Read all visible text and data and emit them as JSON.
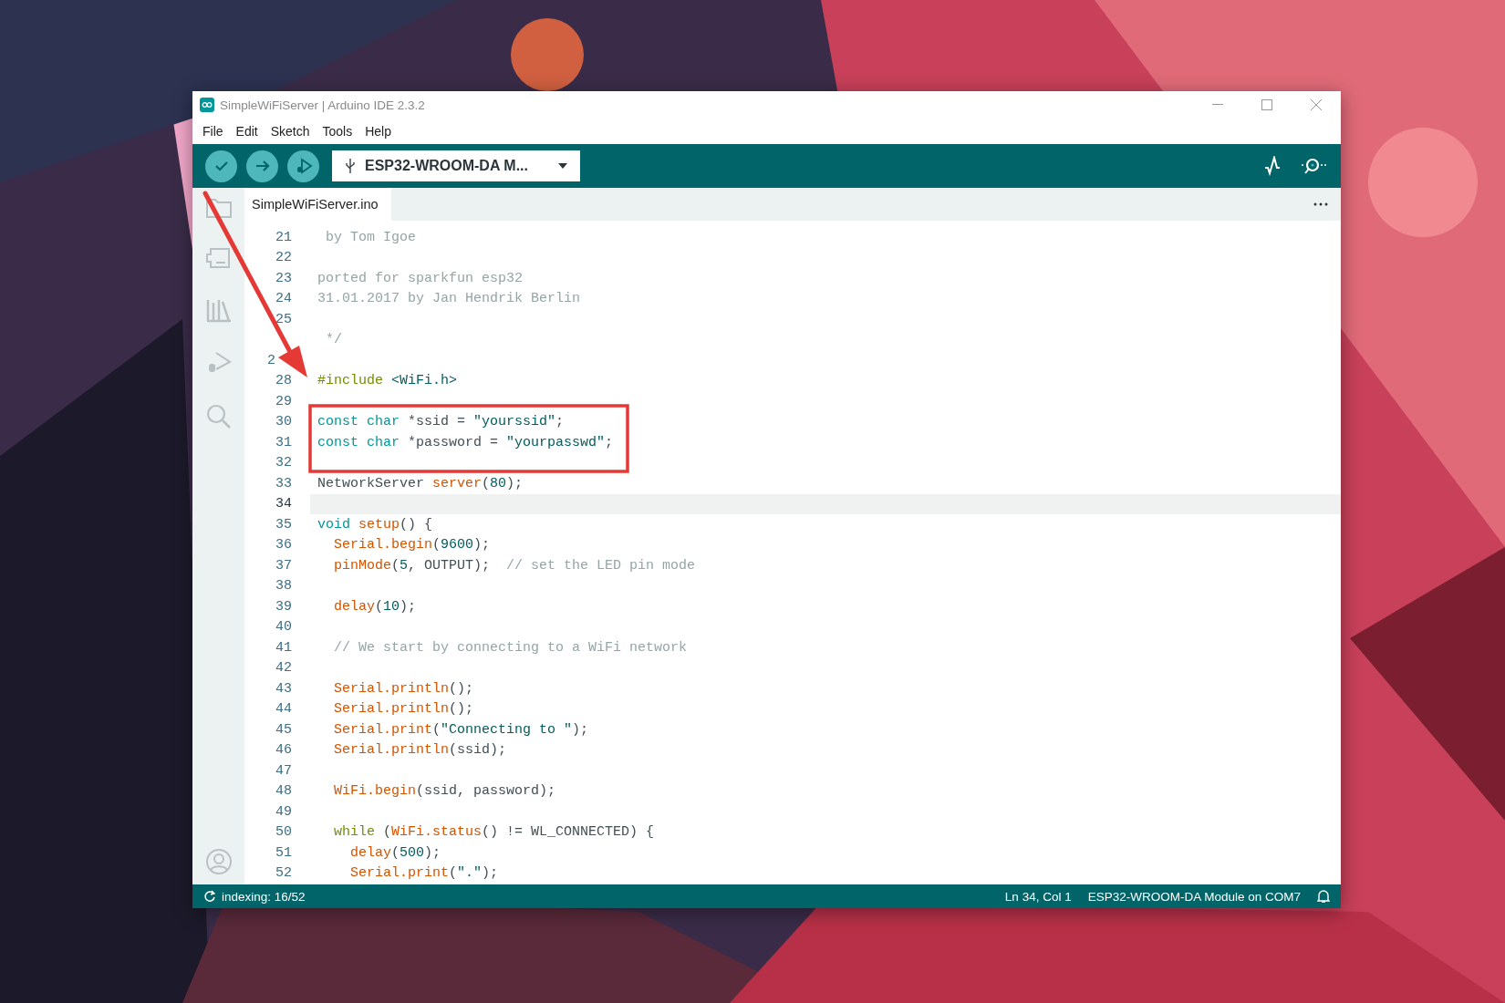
{
  "window": {
    "title": "SimpleWiFiServer | Arduino IDE 2.3.2"
  },
  "menu": [
    "File",
    "Edit",
    "Sketch",
    "Tools",
    "Help"
  ],
  "toolbar": {
    "board_selector": "ESP32-WROOM-DA M..."
  },
  "tabs": [
    {
      "label": "SimpleWiFiServer.ino",
      "selected": true
    }
  ],
  "editor": {
    "lines": [
      {
        "number": "21",
        "tokens": [
          {
            "kind": "comment",
            "text": " by Tom Igoe"
          }
        ]
      },
      {
        "number": "22"
      },
      {
        "number": "23",
        "tokens": [
          {
            "kind": "comment",
            "text": "ported for sparkfun esp32"
          }
        ]
      },
      {
        "number": "24",
        "tokens": [
          {
            "kind": "comment",
            "text": "31.01.2017 by Jan Hendrik Berlin"
          }
        ]
      },
      {
        "number": "25"
      },
      {
        "tokens": [
          {
            "kind": "comment",
            "text": " */"
          }
        ]
      },
      {
        "number": "2"
      },
      {
        "number": "28",
        "tokens": [
          {
            "kind": "preproc",
            "text": "#include"
          },
          {
            "kind": "string",
            "text": " <WiFi.h>"
          }
        ]
      },
      {
        "number": "29"
      },
      {
        "number": "30",
        "tokens": [
          {
            "kind": "keyword",
            "text": "const char"
          },
          {
            "kind": "plain",
            "text": " *ssid = "
          },
          {
            "kind": "string",
            "text": "\"yourssid\""
          },
          {
            "kind": "plain",
            "text": ";"
          }
        ]
      },
      {
        "number": "31",
        "tokens": [
          {
            "kind": "keyword",
            "text": "const char"
          },
          {
            "kind": "plain",
            "text": " *password = "
          },
          {
            "kind": "string",
            "text": "\"yourpasswd\""
          },
          {
            "kind": "plain",
            "text": ";"
          }
        ]
      },
      {
        "number": "32"
      },
      {
        "number": "33",
        "tokens": [
          {
            "kind": "plain",
            "text": "NetworkServer "
          },
          {
            "kind": "function",
            "text": "server"
          },
          {
            "kind": "plain",
            "text": "("
          },
          {
            "kind": "number",
            "text": "80"
          },
          {
            "kind": "plain",
            "text": ");"
          }
        ]
      },
      {
        "number": "34",
        "current": true
      },
      {
        "number": "35",
        "tokens": [
          {
            "kind": "keyword",
            "text": "void"
          },
          {
            "kind": "function",
            "text": " setup"
          },
          {
            "kind": "plain",
            "text": "() {"
          }
        ]
      },
      {
        "number": "36",
        "tokens": [
          {
            "kind": "function",
            "text": "  Serial.begin"
          },
          {
            "kind": "plain",
            "text": "("
          },
          {
            "kind": "number",
            "text": "9600"
          },
          {
            "kind": "plain",
            "text": ");"
          }
        ]
      },
      {
        "number": "37",
        "tokens": [
          {
            "kind": "function",
            "text": "  pinMode"
          },
          {
            "kind": "plain",
            "text": "("
          },
          {
            "kind": "number",
            "text": "5"
          },
          {
            "kind": "plain",
            "text": ", OUTPUT);"
          },
          {
            "kind": "comment",
            "text": "  // set the LED pin mode"
          }
        ]
      },
      {
        "number": "38"
      },
      {
        "number": "39",
        "tokens": [
          {
            "kind": "function",
            "text": "  delay"
          },
          {
            "kind": "plain",
            "text": "("
          },
          {
            "kind": "number",
            "text": "10"
          },
          {
            "kind": "plain",
            "text": ");"
          }
        ]
      },
      {
        "number": "40"
      },
      {
        "number": "41",
        "tokens": [
          {
            "kind": "comment",
            "text": "  // We start by connecting to a WiFi network"
          }
        ]
      },
      {
        "number": "42"
      },
      {
        "number": "43",
        "tokens": [
          {
            "kind": "function",
            "text": "  Serial.println"
          },
          {
            "kind": "plain",
            "text": "();"
          }
        ]
      },
      {
        "number": "44",
        "tokens": [
          {
            "kind": "function",
            "text": "  Serial.println"
          },
          {
            "kind": "plain",
            "text": "();"
          }
        ]
      },
      {
        "number": "45",
        "tokens": [
          {
            "kind": "function",
            "text": "  Serial.print"
          },
          {
            "kind": "plain",
            "text": "("
          },
          {
            "kind": "string",
            "text": "\"Connecting to \""
          },
          {
            "kind": "plain",
            "text": ");"
          }
        ]
      },
      {
        "number": "46",
        "tokens": [
          {
            "kind": "function",
            "text": "  Serial.println"
          },
          {
            "kind": "plain",
            "text": "(ssid);"
          }
        ]
      },
      {
        "number": "47"
      },
      {
        "number": "48",
        "tokens": [
          {
            "kind": "function",
            "text": "  WiFi.begin"
          },
          {
            "kind": "plain",
            "text": "(ssid, password);"
          }
        ]
      },
      {
        "number": "49"
      },
      {
        "number": "50",
        "tokens": [
          {
            "kind": "preproc",
            "text": "  while"
          },
          {
            "kind": "plain",
            "text": " ("
          },
          {
            "kind": "function",
            "text": "WiFi.status"
          },
          {
            "kind": "plain",
            "text": "() != WL_CONNECTED) {"
          }
        ]
      },
      {
        "number": "51",
        "tokens": [
          {
            "kind": "function",
            "text": "    delay"
          },
          {
            "kind": "plain",
            "text": "("
          },
          {
            "kind": "number",
            "text": "500"
          },
          {
            "kind": "plain",
            "text": ");"
          }
        ]
      },
      {
        "number": "52",
        "tokens": [
          {
            "kind": "function",
            "text": "    Serial.print"
          },
          {
            "kind": "plain",
            "text": "("
          },
          {
            "kind": "string",
            "text": "\".\""
          },
          {
            "kind": "plain",
            "text": ");"
          }
        ]
      }
    ]
  },
  "status_bar": {
    "indexing": "indexing: 16/52",
    "position": "Ln 34, Col 1",
    "board": "ESP32-WROOM-DA Module on COM7"
  }
}
